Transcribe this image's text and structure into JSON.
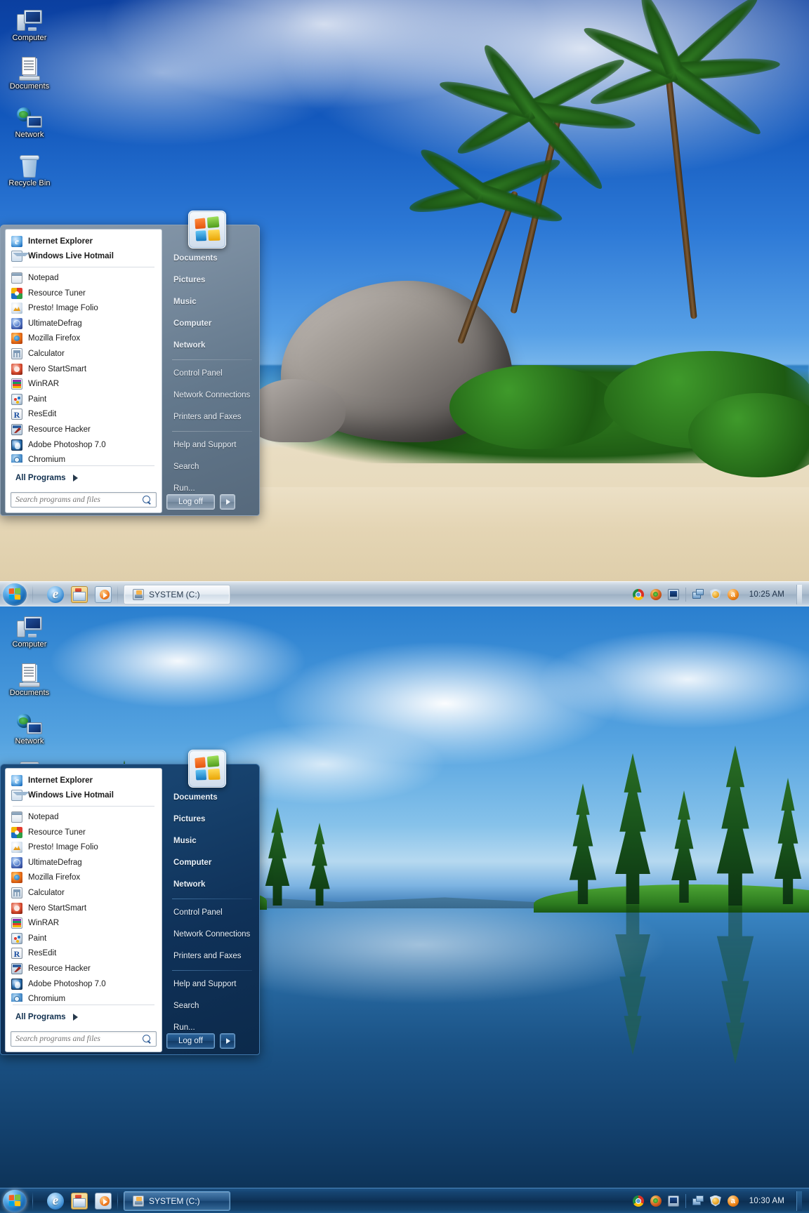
{
  "desktop_icons": [
    {
      "label": "Computer",
      "icon": "computer-icon"
    },
    {
      "label": "Documents",
      "icon": "documents-icon"
    },
    {
      "label": "Network",
      "icon": "network-icon"
    },
    {
      "label": "Recycle Bin",
      "icon": "recycle-bin-icon"
    }
  ],
  "start_menu": {
    "pinned": [
      {
        "label": "Internet Explorer",
        "icon": "internet-explorer-icon"
      },
      {
        "label": "Windows Live Hotmail",
        "icon": "mail-icon"
      }
    ],
    "recent": [
      {
        "label": "Notepad",
        "icon": "notepad-icon"
      },
      {
        "label": "Resource Tuner",
        "icon": "resource-tuner-icon"
      },
      {
        "label": "Presto! Image Folio",
        "icon": "presto-image-folio-icon"
      },
      {
        "label": "UltimateDefrag",
        "icon": "ultimatedefrag-icon"
      },
      {
        "label": "Mozilla Firefox",
        "icon": "firefox-icon"
      },
      {
        "label": "Calculator",
        "icon": "calculator-icon"
      },
      {
        "label": "Nero StartSmart",
        "icon": "nero-icon"
      },
      {
        "label": "WinRAR",
        "icon": "winrar-icon"
      },
      {
        "label": "Paint",
        "icon": "paint-icon"
      },
      {
        "label": "ResEdit",
        "icon": "resedit-icon"
      },
      {
        "label": "Resource Hacker",
        "icon": "resource-hacker-icon"
      },
      {
        "label": "Adobe Photoshop 7.0",
        "icon": "photoshop-icon"
      },
      {
        "label": "Chromium",
        "icon": "chromium-icon"
      }
    ],
    "all_programs_label": "All Programs",
    "search": {
      "placeholder": "Search programs and files",
      "value": "",
      "icon": "search-icon"
    },
    "right_group_1": [
      {
        "label": "Documents"
      },
      {
        "label": "Pictures"
      },
      {
        "label": "Music"
      },
      {
        "label": "Computer"
      },
      {
        "label": "Network"
      }
    ],
    "right_group_2": [
      {
        "label": "Control Panel"
      },
      {
        "label": "Network Connections"
      },
      {
        "label": "Printers and Faxes"
      }
    ],
    "right_group_3": [
      {
        "label": "Help and Support"
      },
      {
        "label": "Search"
      },
      {
        "label": "Run..."
      }
    ],
    "logoff_label": "Log off",
    "shutdown_arrow_icon": "chevron-right-icon",
    "start_orb_icon": "windows-logo-icon"
  },
  "taskbar_top": {
    "start_label": "Start",
    "start_icon": "windows-start-orb-icon",
    "quick_launch": [
      {
        "name": "internet-explorer-icon"
      },
      {
        "name": "windows-explorer-icon"
      },
      {
        "name": "windows-media-player-icon"
      }
    ],
    "windows": [
      {
        "label": "SYSTEM (C:)",
        "icon": "drive-icon"
      }
    ],
    "tray": [
      {
        "name": "chrome-tray-icon"
      },
      {
        "name": "colour-tray-icon"
      },
      {
        "name": "display-tray-icon"
      },
      {
        "name": "network-tray-icon"
      },
      {
        "name": "security-shield-tray-icon"
      },
      {
        "name": "antivirus-tray-icon"
      }
    ],
    "clock": "10:25 AM",
    "theme": "silver"
  },
  "taskbar_bottom": {
    "start_label": "Start",
    "start_icon": "windows-start-orb-icon",
    "quick_launch": [
      {
        "name": "internet-explorer-icon"
      },
      {
        "name": "windows-explorer-icon"
      },
      {
        "name": "windows-media-player-icon"
      }
    ],
    "windows": [
      {
        "label": "SYSTEM (C:)",
        "icon": "drive-icon"
      }
    ],
    "tray": [
      {
        "name": "chrome-tray-icon"
      },
      {
        "name": "colour-tray-icon"
      },
      {
        "name": "display-tray-icon"
      },
      {
        "name": "network-tray-icon"
      },
      {
        "name": "security-shield-tray-icon"
      },
      {
        "name": "antivirus-tray-icon"
      }
    ],
    "clock": "10:30 AM",
    "theme": "navy"
  },
  "colors": {
    "silver_taskbar": "#a8b9cb",
    "navy_taskbar": "#0e3257",
    "silver_menu": "#63788c",
    "navy_menu": "#0f3158",
    "menu_left_bg": "#ffffff",
    "menu_text": "#e8eef5"
  }
}
